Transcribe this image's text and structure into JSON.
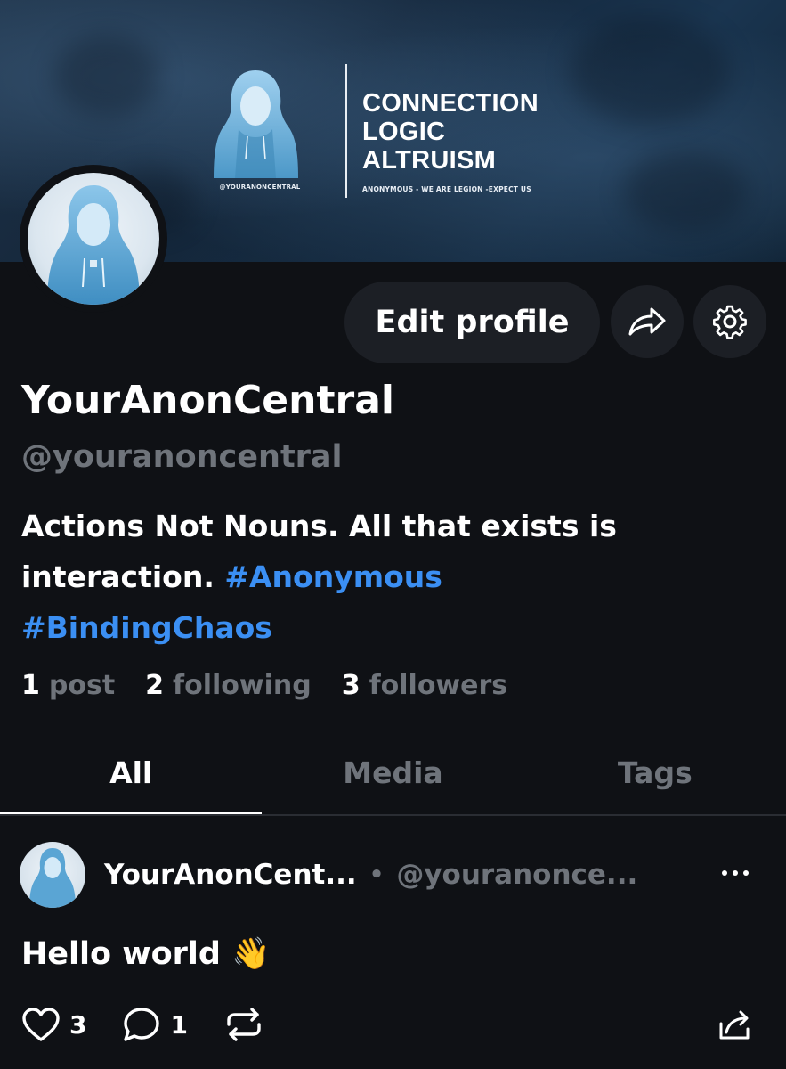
{
  "banner": {
    "words": [
      "CONNECTION",
      "LOGIC",
      "ALTRUISM"
    ],
    "figure_handle": "@YOURANONCENTRAL",
    "tagline": "ANONYMOUS - WE ARE LEGION -EXPECT US"
  },
  "profile": {
    "display_name": "YourAnonCentral",
    "handle": "@youranoncentral",
    "bio_text": "Actions Not Nouns. All that exists is interaction. ",
    "bio_hashtags": [
      "#Anonymous",
      "#BindingChaos"
    ],
    "stats": [
      {
        "count": "1",
        "label": "post"
      },
      {
        "count": "2",
        "label": "following"
      },
      {
        "count": "3",
        "label": "followers"
      }
    ]
  },
  "actions": {
    "edit_label": "Edit profile",
    "share_icon": "share-arrow-icon",
    "settings_icon": "gear-icon"
  },
  "tabs": [
    {
      "label": "All",
      "active": true
    },
    {
      "label": "Media",
      "active": false
    },
    {
      "label": "Tags",
      "active": false
    }
  ],
  "post": {
    "author": "YourAnonCent...",
    "separator": "•",
    "handle": "@youranonce...",
    "more_label": "···",
    "text": "Hello world 👋",
    "likes": "3",
    "replies": "1"
  },
  "colors": {
    "background": "#0f1115",
    "accent_link": "#3b8ff3",
    "muted": "#6f747b",
    "button_bg": "#1c1f25"
  }
}
